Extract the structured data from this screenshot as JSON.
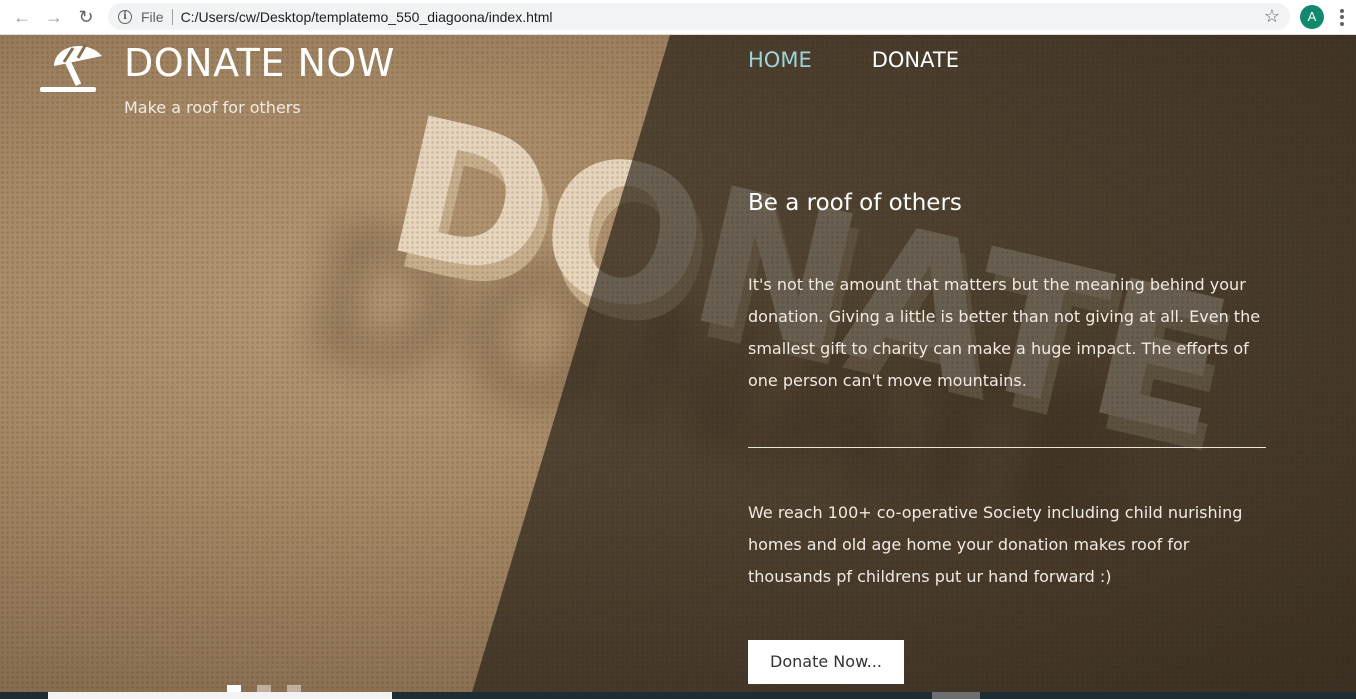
{
  "browser": {
    "back_icon": "arrow-left-icon",
    "forward_icon": "arrow-right-icon",
    "reload_icon": "reload-icon",
    "scheme_label": "File",
    "url": "C:/Users/cw/Desktop/templatemo_550_diagoona/index.html",
    "profile_initial": "A",
    "profile_color": "#12896e"
  },
  "site": {
    "title": "DONATE NOW",
    "tagline": "Make a roof for others",
    "logo_icon": "umbrella-beach-icon"
  },
  "nav": {
    "items": [
      {
        "label": "HOME",
        "active": true
      },
      {
        "label": "DONATE",
        "active": false
      }
    ],
    "active_color": "#9fd3d8"
  },
  "content": {
    "heading": "Be a roof of others",
    "paragraph1": "It's not the amount that matters but the meaning behind your donation. Giving a little is better than not giving at all. Even the smallest gift to charity can make a huge impact. The efforts of one person can't move mountains.",
    "paragraph2": "We reach 100+ co-operative Society including child nurishing homes and old age home your donation makes roof for thousands pf childrens put ur hand forward :)",
    "button_label": "Donate Now..."
  },
  "carousel": {
    "slide_count": 3,
    "active_index": 0
  }
}
